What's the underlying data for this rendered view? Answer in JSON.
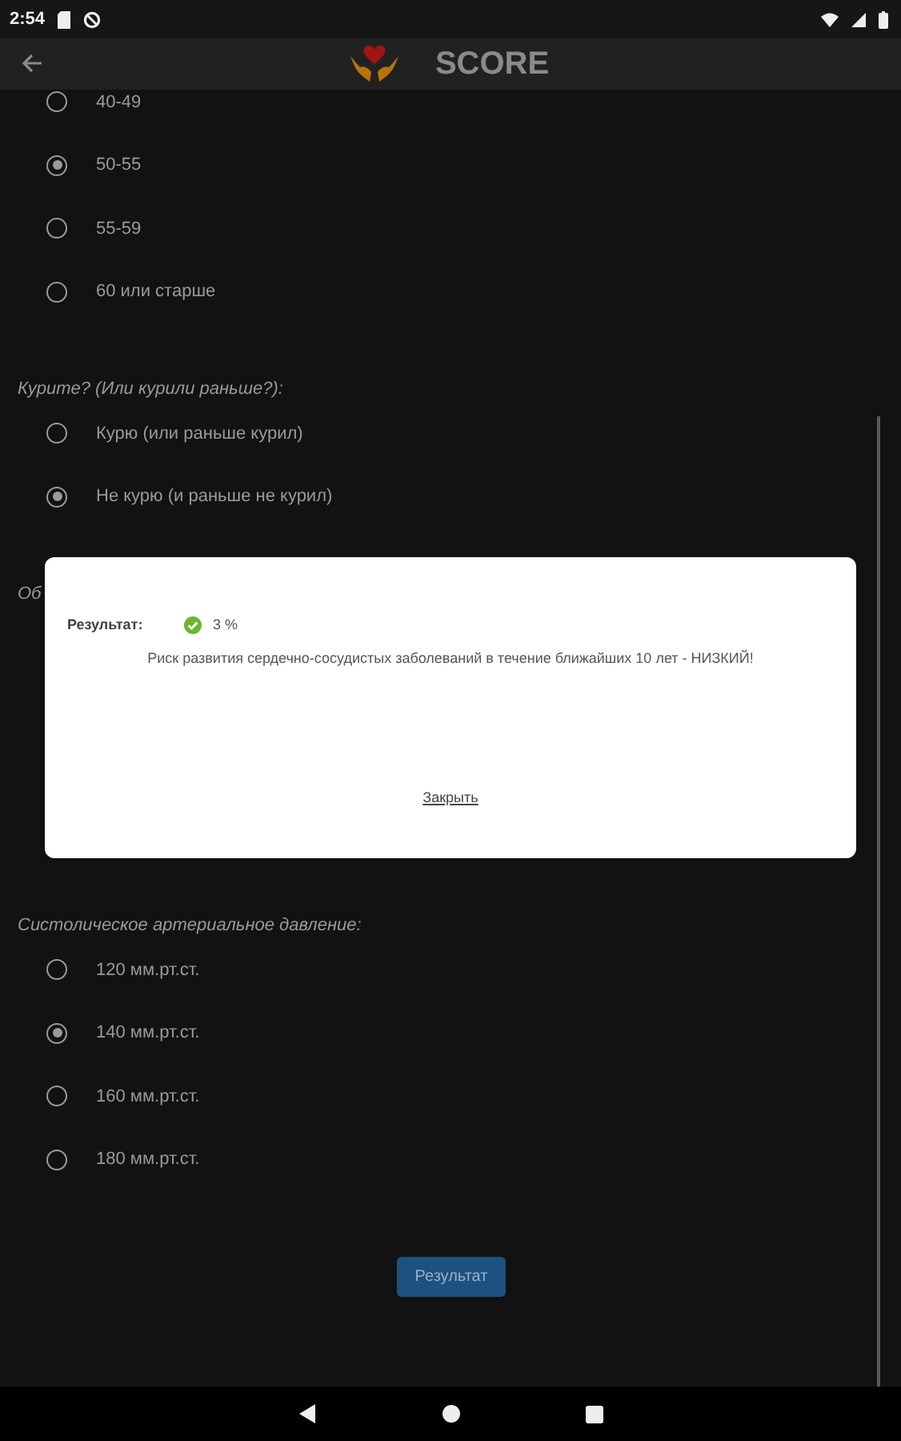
{
  "status_bar": {
    "time": "2:54"
  },
  "toolbar": {
    "title": "SCORE"
  },
  "questions": [
    {
      "options": [
        {
          "label": "40-49",
          "selected": false
        },
        {
          "label": "50-55",
          "selected": true
        },
        {
          "label": "55-59",
          "selected": false
        },
        {
          "label": "60 или старше",
          "selected": false
        }
      ]
    },
    {
      "label": "Курите? (Или курили раньше?):",
      "options": [
        {
          "label": "Курю (или раньше курил)",
          "selected": false
        },
        {
          "label": "Не курю (и раньше не курил)",
          "selected": true
        }
      ]
    },
    {
      "label": "Об"
    },
    {
      "label": "Систолическое артериальное давление:",
      "options": [
        {
          "label": "120 мм.рт.ст.",
          "selected": false
        },
        {
          "label": "140 мм.рт.ст.",
          "selected": true
        },
        {
          "label": "160 мм.рт.ст.",
          "selected": false
        },
        {
          "label": "180 мм.рт.ст.",
          "selected": false
        }
      ]
    }
  ],
  "result_button": "Результат",
  "dialog": {
    "result_label": "Результат:",
    "value": "3 %",
    "message": "Риск развития сердечно-сосудистых заболеваний в течение ближайших 10 лет - НИЗКИЙ!",
    "close": "Закрыть"
  }
}
